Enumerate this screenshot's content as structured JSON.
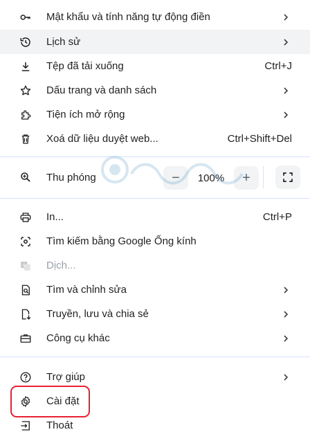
{
  "menu": {
    "group1": [
      {
        "label": "Mật khẩu và tính năng tự động điền",
        "shortcut": "",
        "icon": "key-icon",
        "submenu": true
      },
      {
        "label": "Lịch sử",
        "shortcut": "",
        "icon": "history-icon",
        "submenu": true
      },
      {
        "label": "Tệp đã tải xuống",
        "shortcut": "Ctrl+J",
        "icon": "download-icon",
        "submenu": false
      },
      {
        "label": "Dấu trang và danh sách",
        "shortcut": "",
        "icon": "star-icon",
        "submenu": true
      },
      {
        "label": "Tiện ích mở rộng",
        "shortcut": "",
        "icon": "extension-icon",
        "submenu": true
      },
      {
        "label": "Xoá dữ liệu duyệt web...",
        "shortcut": "Ctrl+Shift+Del",
        "icon": "trash-icon",
        "submenu": false
      }
    ],
    "zoom": {
      "label": "Thu phóng",
      "minus": "−",
      "value": "100%",
      "plus": "+"
    },
    "group2": [
      {
        "label": "In...",
        "shortcut": "Ctrl+P",
        "icon": "print-icon",
        "submenu": false
      },
      {
        "label": "Tìm kiếm bằng Google Ống kính",
        "shortcut": "",
        "icon": "google-lens-icon",
        "submenu": false
      },
      {
        "label": "Dịch...",
        "shortcut": "",
        "icon": "translate-icon",
        "submenu": false
      },
      {
        "label": "Tìm và chỉnh sửa",
        "shortcut": "",
        "icon": "find-edit-icon",
        "submenu": true
      },
      {
        "label": "Truyền, lưu và chia sẻ",
        "shortcut": "",
        "icon": "cast-save-share-icon",
        "submenu": true
      },
      {
        "label": "Công cụ khác",
        "shortcut": "",
        "icon": "toolbox-icon",
        "submenu": true
      }
    ],
    "group3": [
      {
        "label": "Trợ giúp",
        "shortcut": "",
        "icon": "help-icon",
        "submenu": true
      },
      {
        "label": "Cài đặt",
        "shortcut": "",
        "icon": "gear-icon",
        "submenu": false
      },
      {
        "label": "Thoát",
        "shortcut": "",
        "icon": "exit-icon",
        "submenu": false
      }
    ]
  },
  "colors": {
    "hover_bg": "#f1f3f4",
    "divider": "#d3e3fd",
    "highlight_border": "#e8202f",
    "disabled_text": "#9aa0a6"
  }
}
